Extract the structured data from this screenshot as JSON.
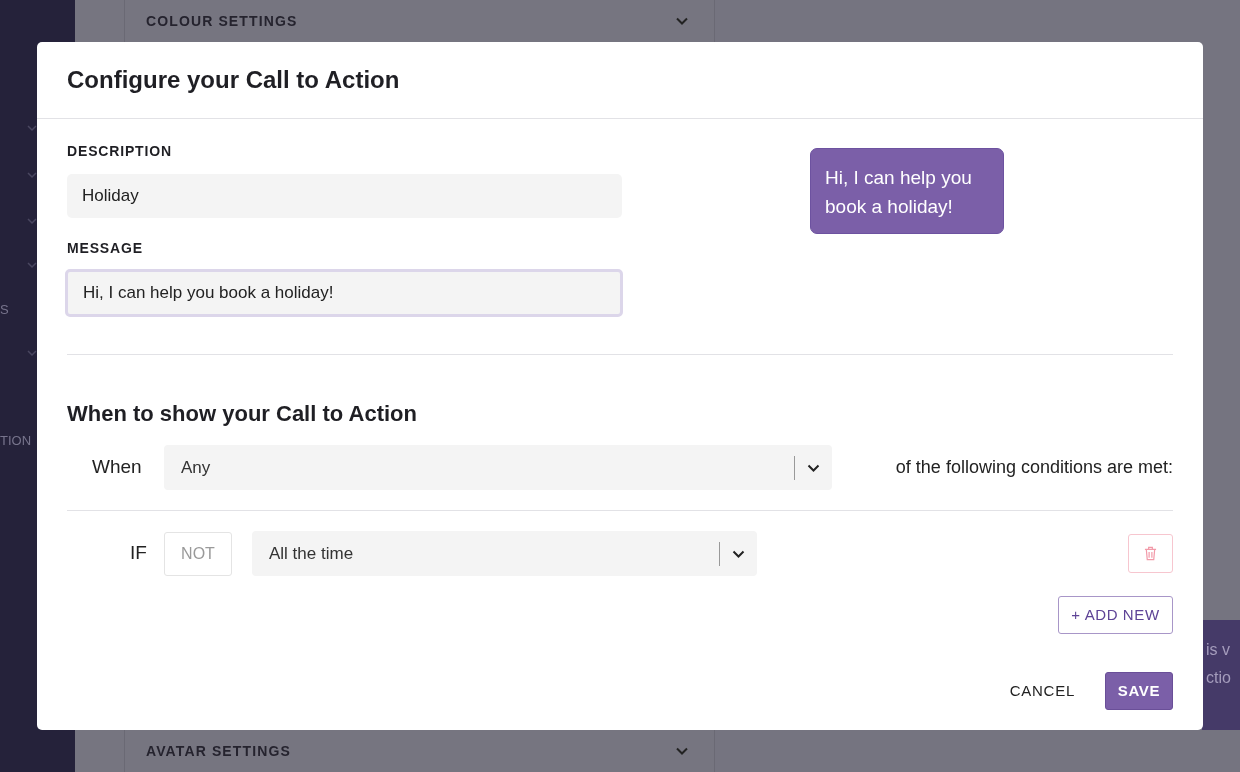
{
  "background": {
    "sidebar_texts": [
      "S",
      "TION"
    ],
    "panels": [
      "COLOUR SETTINGS",
      "AVATAR SETTINGS"
    ],
    "side_note_lines": [
      "is v",
      "ctio"
    ]
  },
  "dialog": {
    "title": "Configure your Call to Action",
    "fields": [
      {
        "label": "DESCRIPTION",
        "value": "Holiday",
        "focused": false
      },
      {
        "label": "MESSAGE",
        "value": "Hi, I can help you book a holiday!",
        "focused": true
      }
    ],
    "preview_bubble": "Hi, I can help you book a holiday!",
    "section_title": "When to show your Call to Action",
    "when": {
      "label": "When",
      "value": "Any",
      "suffix": "of the following conditions are met:"
    },
    "conditions": [
      {
        "label": "IF",
        "not_toggle": "NOT",
        "not_selected": false,
        "value": "All the time"
      }
    ],
    "add_button": "+ ADD NEW",
    "cancel_button": "CANCEL",
    "save_button": "SAVE"
  }
}
